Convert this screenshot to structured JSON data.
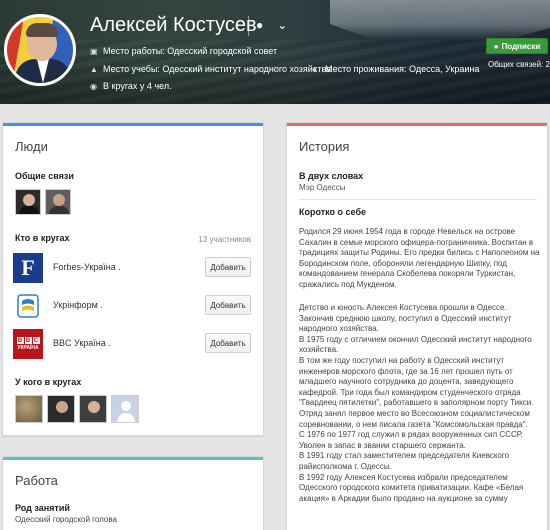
{
  "profile": {
    "name": "Алексей Костусев",
    "work": "Место работы: Одесский городской совет",
    "education": "Место учебы: Одесский институт народного хозяйства",
    "residence": "Место проживания: Одесса, Украина",
    "circles": "В кругах у 4 чел.",
    "subscribe_label": "Подписки",
    "common_connections": "Общих связей: 2"
  },
  "people": {
    "title": "Люди",
    "common_title": "Общие связи",
    "in_circles_title": "Кто в кругах",
    "in_circles_count": "13 участников",
    "rows": [
      {
        "name": "Forbes-Україна .",
        "button": "Добавить",
        "icon": "forbes-logo-icon"
      },
      {
        "name": "Укрінформ .",
        "button": "Добавить",
        "icon": "ukrinform-logo-icon"
      },
      {
        "name": "BBC Україна .",
        "button": "Добавить",
        "icon": "bbc-logo-icon"
      }
    ],
    "has_in_circles_title": "У кого в кругах"
  },
  "work": {
    "title": "Работа",
    "occupation_label": "Род занятий",
    "occupation_value": "Одесский городской голова"
  },
  "history": {
    "title": "История",
    "brief_label": "В двух словах",
    "brief_value": "Мэр Одессы",
    "about_label": "Коротко о себе",
    "para1": "Родился 29 июня 1954 года в городе Невельск на острове Сахалин в семье морского офицера-пограничника. Воспитан в традициях защиты Родины. Его предки бились с Наполеоном на Бородинском поле, обороняли легендарную Шипку, под командованием генерала Скобелева покоряли Туркистан, сражались под Мукденом.",
    "para2": "Детство и юность Алексея Костусева прошли в Одессе. Закончив среднюю школу, поступил в Одесский институт народного хозяйства.\nВ 1975 году с отличием окончил Одесский институт народного хозяйства.\nВ том же году поступил на работу в Одесский институт инженеров морского флота, где за 16 лет прошел путь от младшего научного сотрудника до доцента, заведующего кафедрой. Три года был командиром студенческого отряда \"Гвардеец пятилетки\", работавшего в заполярном порту Тикси. Отряд занял первое место во Всесоюзном социалистическом соревновании, о нем писала газета \"Комсомольская правда\".\nС 1976 по 1977 год служил в рядах вооруженных сил СССР. Уволен в запас в звании старшего сержанта.\nВ 1991 году стал заместителем председателя Киевского райисполкома г. Одессы.\nВ 1992 году Алексея Костусева избрали председателем Одесского городского комитета приватизации. Кафе «Белая акация» в Аркадии было продано на аукционе за сумму"
  },
  "colors": {
    "people_accent": "#4b8bf5",
    "work_accent": "#5bc0c8",
    "history_accent": "#e26c61",
    "subscribe_green": "#3a9a3a"
  }
}
